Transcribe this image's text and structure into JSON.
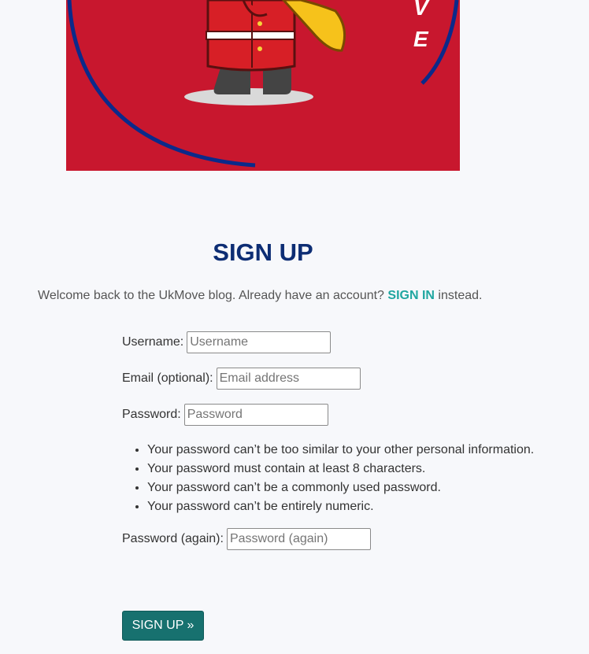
{
  "banner": {
    "letters": [
      "V",
      "E"
    ]
  },
  "page": {
    "title": "SIGN UP",
    "intro_text": "Welcome back to the UkMove blog. Already have an account?",
    "signin_link": "SIGN IN",
    "intro_suffix": "instead."
  },
  "form": {
    "username": {
      "label": "Username:",
      "placeholder": "Username"
    },
    "email": {
      "label": "Email (optional):",
      "placeholder": "Email address"
    },
    "password": {
      "label": "Password:",
      "placeholder": "Password"
    },
    "password_help": [
      "Your password can’t be too similar to your other personal information.",
      "Your password must contain at least 8 characters.",
      "Your password can’t be a commonly used password.",
      "Your password can’t be entirely numeric."
    ],
    "password2": {
      "label": "Password (again):",
      "placeholder": "Password (again)"
    },
    "submit_label": "SIGN UP »"
  },
  "colors": {
    "brand": "#0d2d74",
    "accent": "#1fa6a0",
    "button": "#17716f",
    "banner": "#c8172e"
  }
}
